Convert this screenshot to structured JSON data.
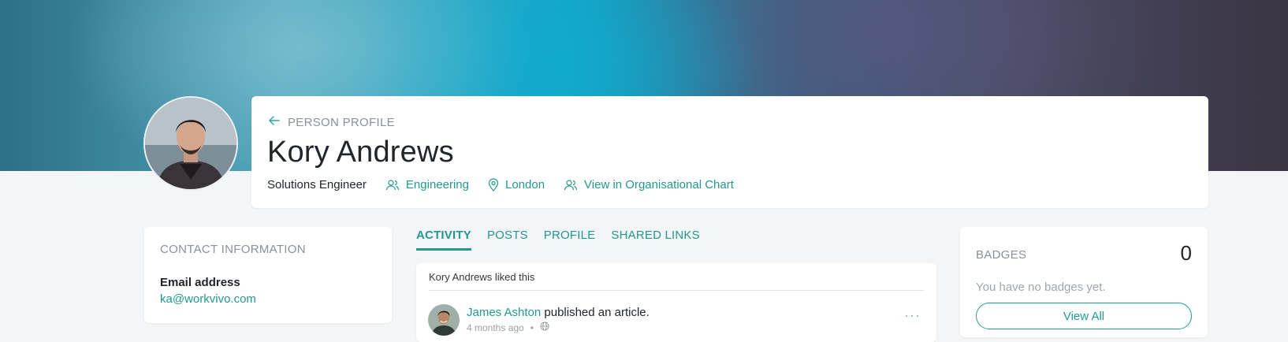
{
  "header": {
    "breadcrumb": "PERSON PROFILE",
    "name": "Kory Andrews",
    "job_title": "Solutions Engineer",
    "department": "Engineering",
    "location": "London",
    "org_chart_link": "View in Organisational Chart"
  },
  "contact": {
    "heading": "CONTACT INFORMATION",
    "email_label": "Email address",
    "email_value": "ka@workvivo.com"
  },
  "tabs": [
    {
      "label": "ACTIVITY",
      "active": true
    },
    {
      "label": "POSTS",
      "active": false
    },
    {
      "label": "PROFILE",
      "active": false
    },
    {
      "label": "SHARED LINKS",
      "active": false
    }
  ],
  "activity": {
    "liked_text": "Kory Andrews liked this",
    "author": "James Ashton",
    "action": " published an article.",
    "time": "4 months ago",
    "separator": "•",
    "more": "···"
  },
  "badges": {
    "heading": "BADGES",
    "count": "0",
    "empty_text": "You have no badges yet.",
    "button": "View All"
  },
  "colors": {
    "accent": "#22998c",
    "page_bg": "#f3f5f6"
  },
  "icons": [
    "back-arrow-icon",
    "people-icon",
    "location-pin-icon",
    "org-chart-icon",
    "globe-icon",
    "more-icon"
  ]
}
